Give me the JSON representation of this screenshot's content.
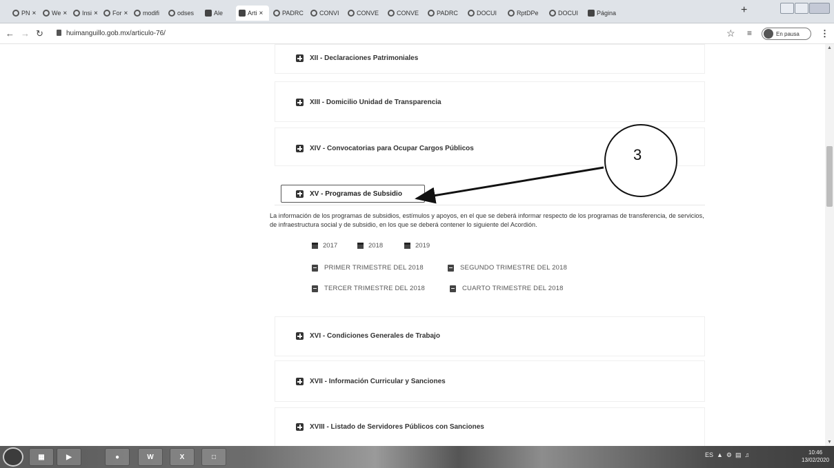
{
  "tabs": [
    {
      "title": "PN",
      "icon": "globe-icon"
    },
    {
      "title": "We",
      "icon": "globe-icon"
    },
    {
      "title": "Insi",
      "icon": "globe-icon"
    },
    {
      "title": "For",
      "icon": "globe-icon"
    },
    {
      "title": "modifi",
      "icon": "globe-icon"
    },
    {
      "title": "odses",
      "icon": "globe-icon"
    },
    {
      "title": "Ale",
      "icon": "video-icon"
    },
    {
      "title": "Arti",
      "icon": "page-icon",
      "active": true
    },
    {
      "title": "PADRC",
      "icon": "globe-icon"
    },
    {
      "title": "CONVI",
      "icon": "globe-icon"
    },
    {
      "title": "CONVE",
      "icon": "globe-icon"
    },
    {
      "title": "CONVE",
      "icon": "globe-icon"
    },
    {
      "title": "PADRC",
      "icon": "globe-icon"
    },
    {
      "title": "DOCUI",
      "icon": "globe-icon"
    },
    {
      "title": "RptDPe",
      "icon": "globe-icon"
    },
    {
      "title": "DOCUI",
      "icon": "globe-icon"
    },
    {
      "title": "Página",
      "icon": "page-icon"
    }
  ],
  "browser": {
    "url": "huimanguillo.gob.mx/articulo-76/",
    "profile_label": "En pausa"
  },
  "sections": {
    "xii": "XII - Declaraciones Patrimoniales",
    "xiii": "XIII - Domicilio Unidad de Transparencia",
    "xiv": "XIV - Convocatorias para Ocupar Cargos Públicos",
    "xv": "XV - Programas de Subsidio",
    "xvi": "XVI - Condiciones Generales de Trabajo",
    "xvii": "XVII - Información Curricular y Sanciones",
    "xviii": "XVIII - Listado de Servidores Públicos con Sanciones"
  },
  "xv_panel": {
    "description": "La información de los programas de subsidios, estímulos y apoyos, en el que se deberá informar respecto de los programas de transferencia, de servicios, de infraestructura social y de subsidio, en los que se deberá contener lo siguiente del Acordión.",
    "years": [
      "2017",
      "2018",
      "2019"
    ],
    "documents": [
      "PRIMER TRIMESTRE DEL 2018",
      "SEGUNDO TRIMESTRE DEL 2018",
      "TERCER TRIMESTRE DEL 2018",
      "CUARTO TRIMESTRE DEL 2018"
    ]
  },
  "annotation": {
    "number": "3",
    "color": "#111111"
  },
  "taskbar": {
    "apps": [
      "W",
      "X"
    ],
    "tray_lang": "ES",
    "clock_time": "10:46",
    "clock_date": "13/02/2020"
  },
  "colors": {
    "section_border": "#efefef",
    "text": "#333333",
    "tabbar": "#dfe3e8"
  }
}
